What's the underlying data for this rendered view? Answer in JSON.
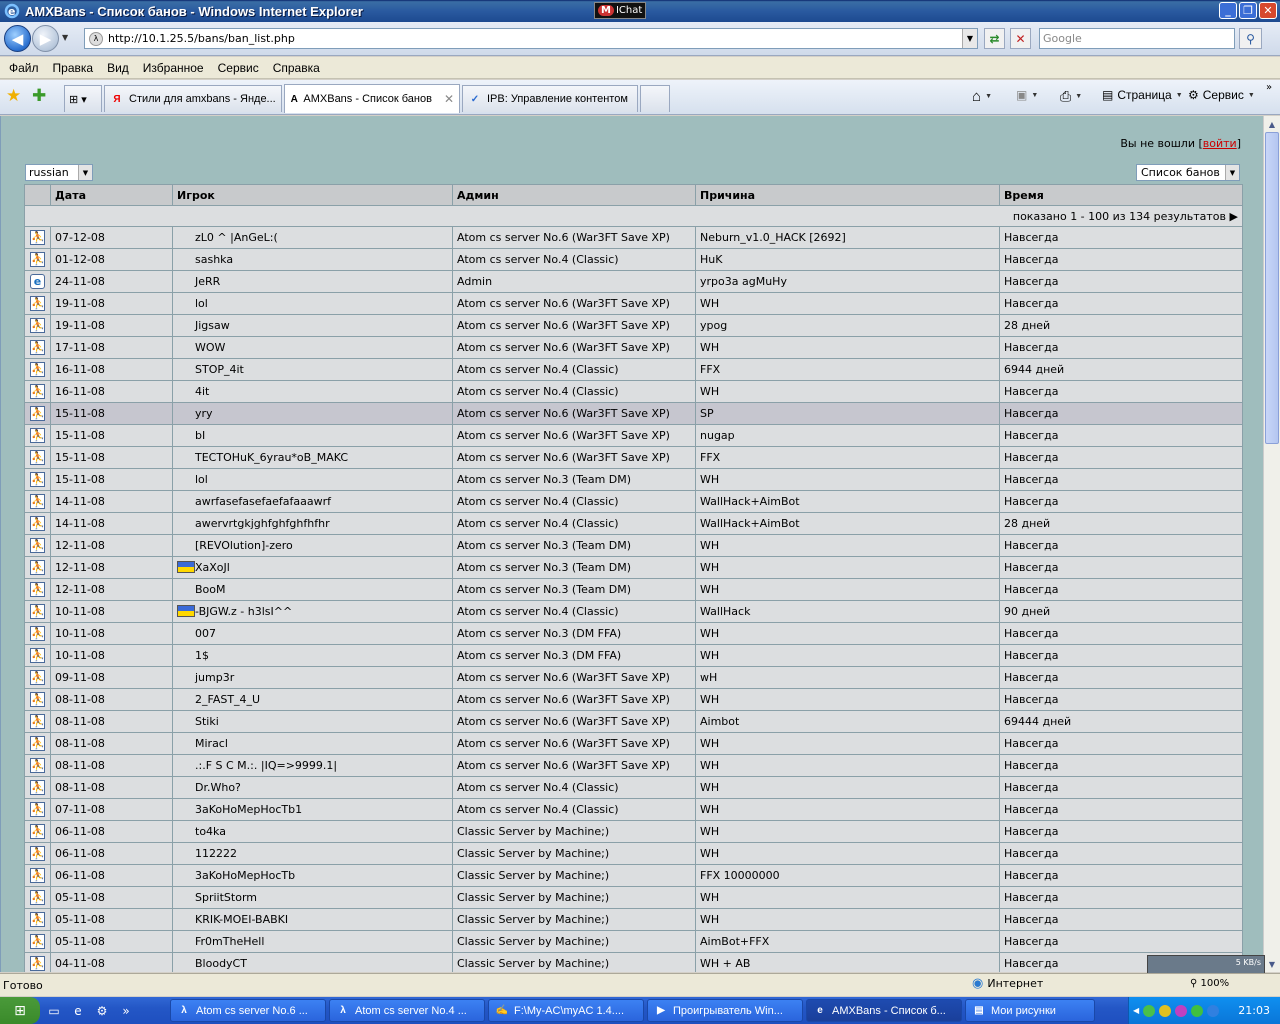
{
  "window": {
    "title": "AMXBans - Список банов - Windows Internet Explorer",
    "chat_badge": "M",
    "chat_label": "IChat"
  },
  "address": {
    "url": "http://10.1.25.5/bans/ban_list.php",
    "search_placeholder": "Google"
  },
  "menu": [
    "Файл",
    "Правка",
    "Вид",
    "Избранное",
    "Сервис",
    "Справка"
  ],
  "tabs": [
    {
      "label": "Стили для amxbans - Янде...",
      "icon": "Я"
    },
    {
      "label": "AMXBans - Список банов",
      "icon": "A"
    },
    {
      "label": "IPB: Управление контентом",
      "icon": "✓"
    }
  ],
  "toolbar_right": {
    "page_label": "Страница",
    "tools_label": "Сервис"
  },
  "page": {
    "login_prefix": "Вы не вошли [",
    "login_link": "войти",
    "login_suffix": "]",
    "language": "russian",
    "list_select": "Список банов",
    "columns": [
      "Дата",
      "Игрок",
      "Админ",
      "Причина",
      "Время"
    ],
    "pager": "показано 1 - 100 из 134 результатов"
  },
  "bans": [
    {
      "date": "07-12-08",
      "player": "zL0 ^ |AnGeL:(",
      "admin": "Atom cs server No.6 (War3FT Save XP)",
      "reason": "Neburn_v1.0_HACK [2692]",
      "time": "Навсегда"
    },
    {
      "date": "01-12-08",
      "player": "sashka",
      "admin": "Atom cs server No.4 (Classic)",
      "reason": "HuK",
      "time": "Навсегда"
    },
    {
      "date": "24-11-08",
      "player": "JeRR",
      "admin": "Admin",
      "reason": "yrpo3a agMuHy",
      "time": "Навсегда",
      "web": true
    },
    {
      "date": "19-11-08",
      "player": "lol",
      "admin": "Atom cs server No.6 (War3FT Save XP)",
      "reason": "WH",
      "time": "Навсегда"
    },
    {
      "date": "19-11-08",
      "player": "Jigsaw",
      "admin": "Atom cs server No.6 (War3FT Save XP)",
      "reason": "ypog",
      "time": "28 дней"
    },
    {
      "date": "17-11-08",
      "player": "WOW",
      "admin": "Atom cs server No.6 (War3FT Save XP)",
      "reason": "WH",
      "time": "Навсегда"
    },
    {
      "date": "16-11-08",
      "player": "STOP_4it",
      "admin": "Atom cs server No.4 (Classic)",
      "reason": "FFX",
      "time": "6944 дней"
    },
    {
      "date": "16-11-08",
      "player": "4it",
      "admin": "Atom cs server No.4 (Classic)",
      "reason": "WH",
      "time": "Навсегда"
    },
    {
      "date": "15-11-08",
      "player": "yry",
      "admin": "Atom cs server No.6 (War3FT Save XP)",
      "reason": "SP",
      "time": "Навсегда",
      "hl": true
    },
    {
      "date": "15-11-08",
      "player": "bI",
      "admin": "Atom cs server No.6 (War3FT Save XP)",
      "reason": "nugap",
      "time": "Навсегда"
    },
    {
      "date": "15-11-08",
      "player": "TECTOHuK_6yrau*oB_MAKC",
      "admin": "Atom cs server No.6 (War3FT Save XP)",
      "reason": "FFX",
      "time": "Навсегда"
    },
    {
      "date": "15-11-08",
      "player": "lol",
      "admin": "Atom cs server No.3 (Team DM)",
      "reason": "WH",
      "time": "Навсегда"
    },
    {
      "date": "14-11-08",
      "player": "awrfasefasefaefafaaawrf",
      "admin": "Atom cs server No.4 (Classic)",
      "reason": "WallHack+AimBot",
      "time": "Навсегда"
    },
    {
      "date": "14-11-08",
      "player": "awervrtgkjghfghfghfhfhr",
      "admin": "Atom cs server No.4 (Classic)",
      "reason": "WallHack+AimBot",
      "time": "28 дней"
    },
    {
      "date": "12-11-08",
      "player": "[REVOlution]-zero",
      "admin": "Atom cs server No.3 (Team DM)",
      "reason": "WH",
      "time": "Навсегда"
    },
    {
      "date": "12-11-08",
      "player": "XaXoJl",
      "admin": "Atom cs server No.3 (Team DM)",
      "reason": "WH",
      "time": "Навсегда",
      "flag": true
    },
    {
      "date": "12-11-08",
      "player": "BooM",
      "admin": "Atom cs server No.3 (Team DM)",
      "reason": "WH",
      "time": "Навсегда"
    },
    {
      "date": "10-11-08",
      "player": "-BJGW.z - h3lsI^^",
      "admin": "Atom cs server No.4 (Classic)",
      "reason": "WallHack",
      "time": "90 дней",
      "flag": true
    },
    {
      "date": "10-11-08",
      "player": "007",
      "admin": "Atom cs server No.3 (DM FFA)",
      "reason": "WH",
      "time": "Навсегда"
    },
    {
      "date": "10-11-08",
      "player": "1$",
      "admin": "Atom cs server No.3 (DM FFA)",
      "reason": "WH",
      "time": "Навсегда"
    },
    {
      "date": "09-11-08",
      "player": "jump3r",
      "admin": "Atom cs server No.6 (War3FT Save XP)",
      "reason": "wH",
      "time": "Навсегда"
    },
    {
      "date": "08-11-08",
      "player": "2_FAST_4_U",
      "admin": "Atom cs server No.6 (War3FT Save XP)",
      "reason": "WH",
      "time": "Навсегда"
    },
    {
      "date": "08-11-08",
      "player": "Stiki",
      "admin": "Atom cs server No.6 (War3FT Save XP)",
      "reason": "Aimbot",
      "time": "69444 дней"
    },
    {
      "date": "08-11-08",
      "player": "Miracl",
      "admin": "Atom cs server No.6 (War3FT Save XP)",
      "reason": "WH",
      "time": "Навсегда"
    },
    {
      "date": "08-11-08",
      "player": ".:.F S C M.:. |IQ=>9999.1|",
      "admin": "Atom cs server No.6 (War3FT Save XP)",
      "reason": "WH",
      "time": "Навсегда"
    },
    {
      "date": "08-11-08",
      "player": "Dr.Who?",
      "admin": "Atom cs server No.4 (Classic)",
      "reason": "WH",
      "time": "Навсегда"
    },
    {
      "date": "07-11-08",
      "player": "3aKoHoMepHocTb1",
      "admin": "Atom cs server No.4 (Classic)",
      "reason": "WH",
      "time": "Навсегда"
    },
    {
      "date": "06-11-08",
      "player": "to4ka",
      "admin": "Classic Server by Machine;)",
      "reason": "WH",
      "time": "Навсегда"
    },
    {
      "date": "06-11-08",
      "player": "112222",
      "admin": "Classic Server by Machine;)",
      "reason": "WH",
      "time": "Навсегда"
    },
    {
      "date": "06-11-08",
      "player": "3aKoHoMepHocTb",
      "admin": "Classic Server by Machine;)",
      "reason": "FFX 10000000",
      "time": "Навсегда"
    },
    {
      "date": "05-11-08",
      "player": "SpriitStorm",
      "admin": "Classic Server by Machine;)",
      "reason": "WH",
      "time": "Навсегда"
    },
    {
      "date": "05-11-08",
      "player": "KRIK-MOEI-BABKI",
      "admin": "Classic Server by Machine;)",
      "reason": "WH",
      "time": "Навсегда"
    },
    {
      "date": "05-11-08",
      "player": "Fr0mTheHell",
      "admin": "Classic Server by Machine;)",
      "reason": "AimBot+FFX",
      "time": "Навсегда"
    },
    {
      "date": "04-11-08",
      "player": "BloodyCT",
      "admin": "Classic Server by Machine;)",
      "reason": "WH + AB",
      "time": "Навсегда"
    }
  ],
  "status": {
    "text": "Готово",
    "zone": "Интернет",
    "zoom": "100%",
    "netspeed": "5 KB/s"
  },
  "taskbar": {
    "buttons": [
      {
        "label": "Atom cs server No.6 ...",
        "icon": "λ"
      },
      {
        "label": "Atom cs server No.4 ...",
        "icon": "λ"
      },
      {
        "label": "F:\\My-AC\\myAC 1.4....",
        "icon": "✍"
      },
      {
        "label": "Проигрыватель Win...",
        "icon": "▶"
      },
      {
        "label": "AMXBans - Список б...",
        "icon": "e"
      },
      {
        "label": "Мои рисунки",
        "icon": "▤"
      }
    ],
    "clock": "21:03"
  }
}
